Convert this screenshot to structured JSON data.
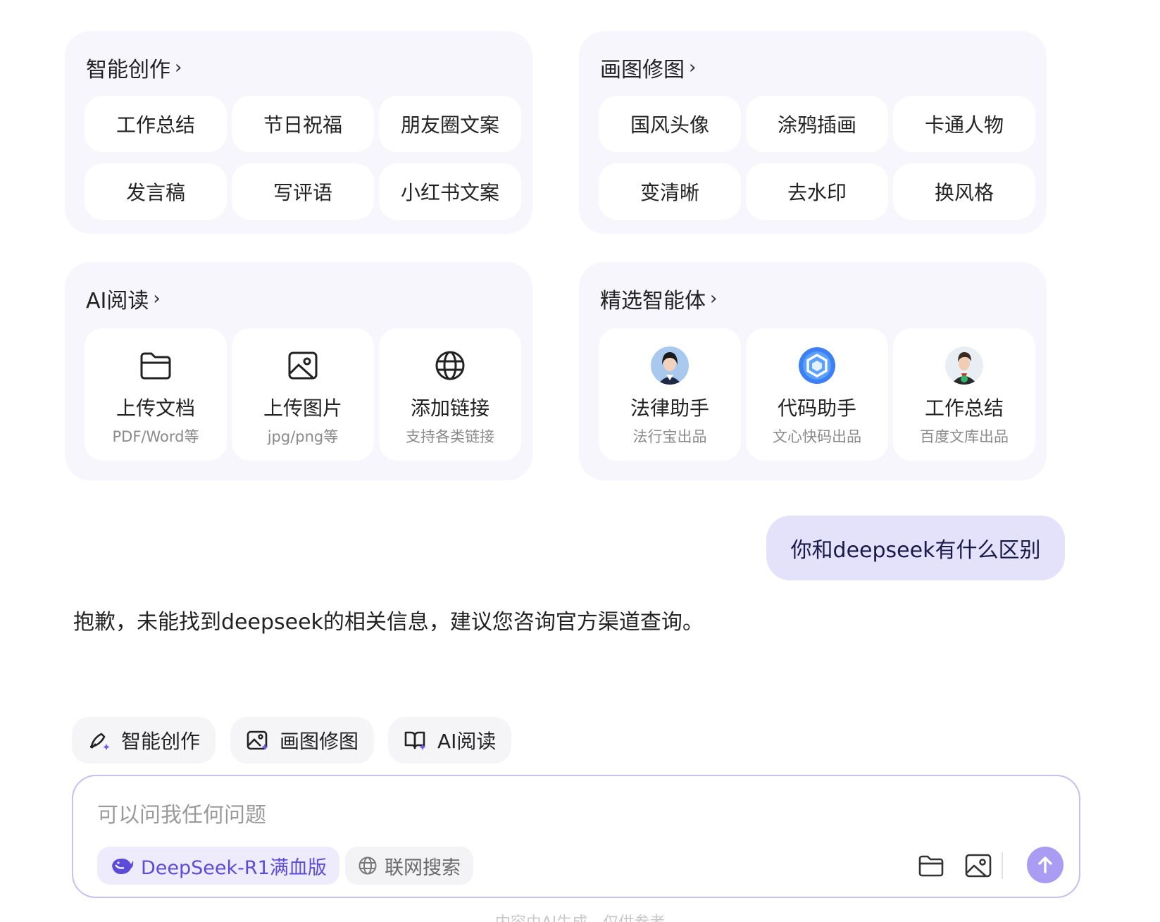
{
  "cards": {
    "creation": {
      "title": "智能创作",
      "chips": [
        "工作总结",
        "节日祝福",
        "朋友圈文案",
        "发言稿",
        "写评语",
        "小红书文案"
      ]
    },
    "drawing": {
      "title": "画图修图",
      "chips": [
        "国风头像",
        "涂鸦插画",
        "卡通人物",
        "变清晰",
        "去水印",
        "换风格"
      ]
    },
    "reading": {
      "title": "AI阅读",
      "tiles": [
        {
          "title": "上传文档",
          "sub": "PDF/Word等",
          "icon": "folder-icon"
        },
        {
          "title": "上传图片",
          "sub": "jpg/png等",
          "icon": "image-icon"
        },
        {
          "title": "添加链接",
          "sub": "支持各类链接",
          "icon": "globe-icon"
        }
      ]
    },
    "agents": {
      "title": "精选智能体",
      "tiles": [
        {
          "title": "法律助手",
          "sub": "法行宝出品",
          "icon": "lawyer-avatar"
        },
        {
          "title": "代码助手",
          "sub": "文心快码出品",
          "icon": "code-logo"
        },
        {
          "title": "工作总结",
          "sub": "百度文库出品",
          "icon": "worker-avatar"
        }
      ]
    }
  },
  "chat": {
    "user_message": "你和deepseek有什么区别",
    "assistant_message": "抱歉，未能找到deepseek的相关信息，建议您咨询官方渠道查询。"
  },
  "quick_actions": [
    "智能创作",
    "画图修图",
    "AI阅读"
  ],
  "input": {
    "placeholder": "可以问我任何问题",
    "model_label": "DeepSeek-R1满血版",
    "web_search_label": "联网搜索"
  },
  "footer_note": "内容由AI生成，仅供参考",
  "colors": {
    "accent": "#a99cf2",
    "card_bg": "#f6f6fc",
    "bubble_bg": "#e4e1fb",
    "model_text": "#5b4bd8"
  }
}
